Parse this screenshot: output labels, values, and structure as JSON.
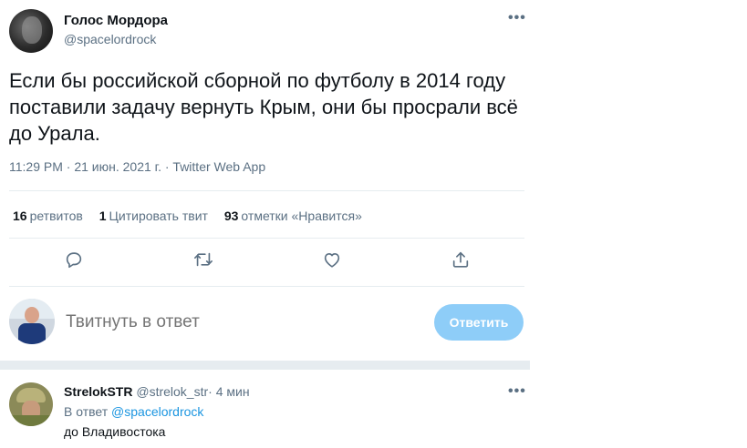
{
  "tweet": {
    "author_name": "Голос Мордора",
    "author_handle": "@spacelordrock",
    "more_icon": "•••",
    "text": "Если бы российской сборной по футболу в 2014 году поставили задачу вернуть Крым, они бы просрали всё до Урала.",
    "time": "11:29 PM",
    "date": "21 июн. 2021 г.",
    "source": "Twitter Web App",
    "meta_sep": "·"
  },
  "stats": {
    "retweets_count": "16",
    "retweets_label": "ретвитов",
    "quotes_count": "1",
    "quotes_label": "Цитировать твит",
    "likes_count": "93",
    "likes_label": "отметки «Нравится»"
  },
  "actions": [
    {
      "icon": "reply-icon"
    },
    {
      "icon": "retweet-icon"
    },
    {
      "icon": "like-icon"
    },
    {
      "icon": "share-icon"
    }
  ],
  "reply_composer": {
    "placeholder": "Твитнуть в ответ",
    "button_label": "Ответить",
    "button_color": "#8ecdf8"
  },
  "reply": {
    "author_name": "StrelokSTR",
    "author_handle": "@strelok_str",
    "sep": "·",
    "time": "4 мин",
    "more_icon": "•••",
    "in_reply_prefix": "В ответ",
    "in_reply_mention": "@spacelordrock",
    "text": "до Владивостока"
  },
  "colors": {
    "text": "#0f1419",
    "secondary": "#5b7083",
    "link": "#1b95e0",
    "divider": "#e6ecf0"
  }
}
